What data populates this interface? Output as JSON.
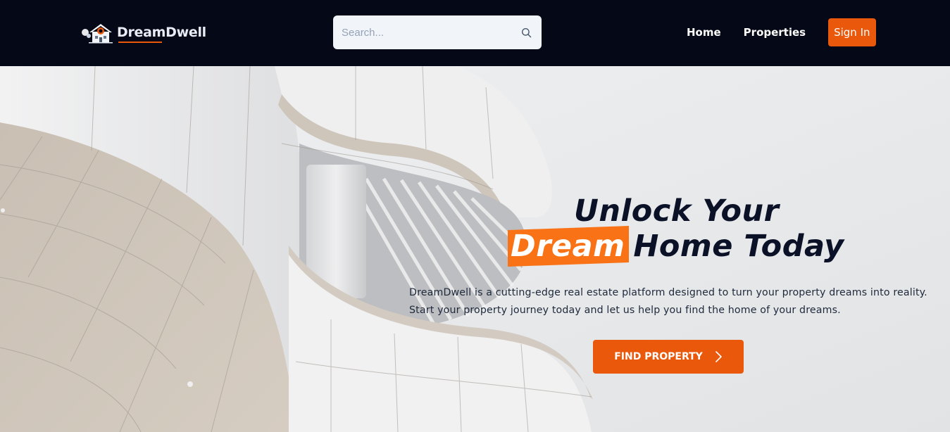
{
  "brand": {
    "name": "DreamDwell",
    "icon": "house-logo-icon",
    "accent": "#ea580c"
  },
  "search": {
    "placeholder": "Search...",
    "value": "",
    "icon": "search-icon"
  },
  "nav": {
    "items": [
      {
        "label": "Home"
      },
      {
        "label": "Properties"
      }
    ],
    "signin_label": "Sign In"
  },
  "hero": {
    "headline_line1": "Unlock Your",
    "headline_highlight": "Dream",
    "headline_rest": "Home Today",
    "description_line1": "DreamDwell is a cutting-edge real estate platform designed to turn your property dreams into reality.",
    "description_line2": "Start your property journey today and let us help you find the home of your dreams.",
    "cta_label": "FIND PROPERTY",
    "cta_icon": "chevron-right-icon"
  },
  "colors": {
    "navbar_bg": "#050816",
    "primary": "#ea580c",
    "highlight": "#f97316",
    "heading": "#0b1127"
  }
}
